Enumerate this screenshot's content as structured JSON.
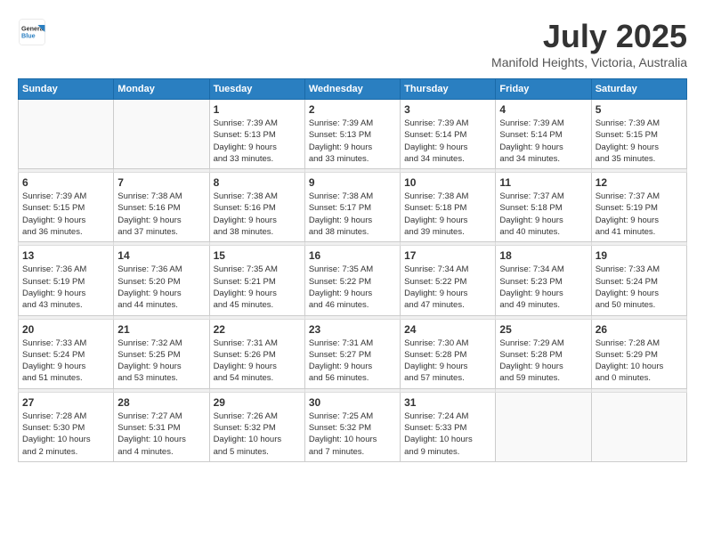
{
  "header": {
    "logo_line1": "General",
    "logo_line2": "Blue",
    "month": "July 2025",
    "location": "Manifold Heights, Victoria, Australia"
  },
  "weekdays": [
    "Sunday",
    "Monday",
    "Tuesday",
    "Wednesday",
    "Thursday",
    "Friday",
    "Saturday"
  ],
  "weeks": [
    [
      {
        "day": "",
        "info": ""
      },
      {
        "day": "",
        "info": ""
      },
      {
        "day": "1",
        "info": "Sunrise: 7:39 AM\nSunset: 5:13 PM\nDaylight: 9 hours\nand 33 minutes."
      },
      {
        "day": "2",
        "info": "Sunrise: 7:39 AM\nSunset: 5:13 PM\nDaylight: 9 hours\nand 33 minutes."
      },
      {
        "day": "3",
        "info": "Sunrise: 7:39 AM\nSunset: 5:14 PM\nDaylight: 9 hours\nand 34 minutes."
      },
      {
        "day": "4",
        "info": "Sunrise: 7:39 AM\nSunset: 5:14 PM\nDaylight: 9 hours\nand 34 minutes."
      },
      {
        "day": "5",
        "info": "Sunrise: 7:39 AM\nSunset: 5:15 PM\nDaylight: 9 hours\nand 35 minutes."
      }
    ],
    [
      {
        "day": "6",
        "info": "Sunrise: 7:39 AM\nSunset: 5:15 PM\nDaylight: 9 hours\nand 36 minutes."
      },
      {
        "day": "7",
        "info": "Sunrise: 7:38 AM\nSunset: 5:16 PM\nDaylight: 9 hours\nand 37 minutes."
      },
      {
        "day": "8",
        "info": "Sunrise: 7:38 AM\nSunset: 5:16 PM\nDaylight: 9 hours\nand 38 minutes."
      },
      {
        "day": "9",
        "info": "Sunrise: 7:38 AM\nSunset: 5:17 PM\nDaylight: 9 hours\nand 38 minutes."
      },
      {
        "day": "10",
        "info": "Sunrise: 7:38 AM\nSunset: 5:18 PM\nDaylight: 9 hours\nand 39 minutes."
      },
      {
        "day": "11",
        "info": "Sunrise: 7:37 AM\nSunset: 5:18 PM\nDaylight: 9 hours\nand 40 minutes."
      },
      {
        "day": "12",
        "info": "Sunrise: 7:37 AM\nSunset: 5:19 PM\nDaylight: 9 hours\nand 41 minutes."
      }
    ],
    [
      {
        "day": "13",
        "info": "Sunrise: 7:36 AM\nSunset: 5:19 PM\nDaylight: 9 hours\nand 43 minutes."
      },
      {
        "day": "14",
        "info": "Sunrise: 7:36 AM\nSunset: 5:20 PM\nDaylight: 9 hours\nand 44 minutes."
      },
      {
        "day": "15",
        "info": "Sunrise: 7:35 AM\nSunset: 5:21 PM\nDaylight: 9 hours\nand 45 minutes."
      },
      {
        "day": "16",
        "info": "Sunrise: 7:35 AM\nSunset: 5:22 PM\nDaylight: 9 hours\nand 46 minutes."
      },
      {
        "day": "17",
        "info": "Sunrise: 7:34 AM\nSunset: 5:22 PM\nDaylight: 9 hours\nand 47 minutes."
      },
      {
        "day": "18",
        "info": "Sunrise: 7:34 AM\nSunset: 5:23 PM\nDaylight: 9 hours\nand 49 minutes."
      },
      {
        "day": "19",
        "info": "Sunrise: 7:33 AM\nSunset: 5:24 PM\nDaylight: 9 hours\nand 50 minutes."
      }
    ],
    [
      {
        "day": "20",
        "info": "Sunrise: 7:33 AM\nSunset: 5:24 PM\nDaylight: 9 hours\nand 51 minutes."
      },
      {
        "day": "21",
        "info": "Sunrise: 7:32 AM\nSunset: 5:25 PM\nDaylight: 9 hours\nand 53 minutes."
      },
      {
        "day": "22",
        "info": "Sunrise: 7:31 AM\nSunset: 5:26 PM\nDaylight: 9 hours\nand 54 minutes."
      },
      {
        "day": "23",
        "info": "Sunrise: 7:31 AM\nSunset: 5:27 PM\nDaylight: 9 hours\nand 56 minutes."
      },
      {
        "day": "24",
        "info": "Sunrise: 7:30 AM\nSunset: 5:28 PM\nDaylight: 9 hours\nand 57 minutes."
      },
      {
        "day": "25",
        "info": "Sunrise: 7:29 AM\nSunset: 5:28 PM\nDaylight: 9 hours\nand 59 minutes."
      },
      {
        "day": "26",
        "info": "Sunrise: 7:28 AM\nSunset: 5:29 PM\nDaylight: 10 hours\nand 0 minutes."
      }
    ],
    [
      {
        "day": "27",
        "info": "Sunrise: 7:28 AM\nSunset: 5:30 PM\nDaylight: 10 hours\nand 2 minutes."
      },
      {
        "day": "28",
        "info": "Sunrise: 7:27 AM\nSunset: 5:31 PM\nDaylight: 10 hours\nand 4 minutes."
      },
      {
        "day": "29",
        "info": "Sunrise: 7:26 AM\nSunset: 5:32 PM\nDaylight: 10 hours\nand 5 minutes."
      },
      {
        "day": "30",
        "info": "Sunrise: 7:25 AM\nSunset: 5:32 PM\nDaylight: 10 hours\nand 7 minutes."
      },
      {
        "day": "31",
        "info": "Sunrise: 7:24 AM\nSunset: 5:33 PM\nDaylight: 10 hours\nand 9 minutes."
      },
      {
        "day": "",
        "info": ""
      },
      {
        "day": "",
        "info": ""
      }
    ]
  ]
}
